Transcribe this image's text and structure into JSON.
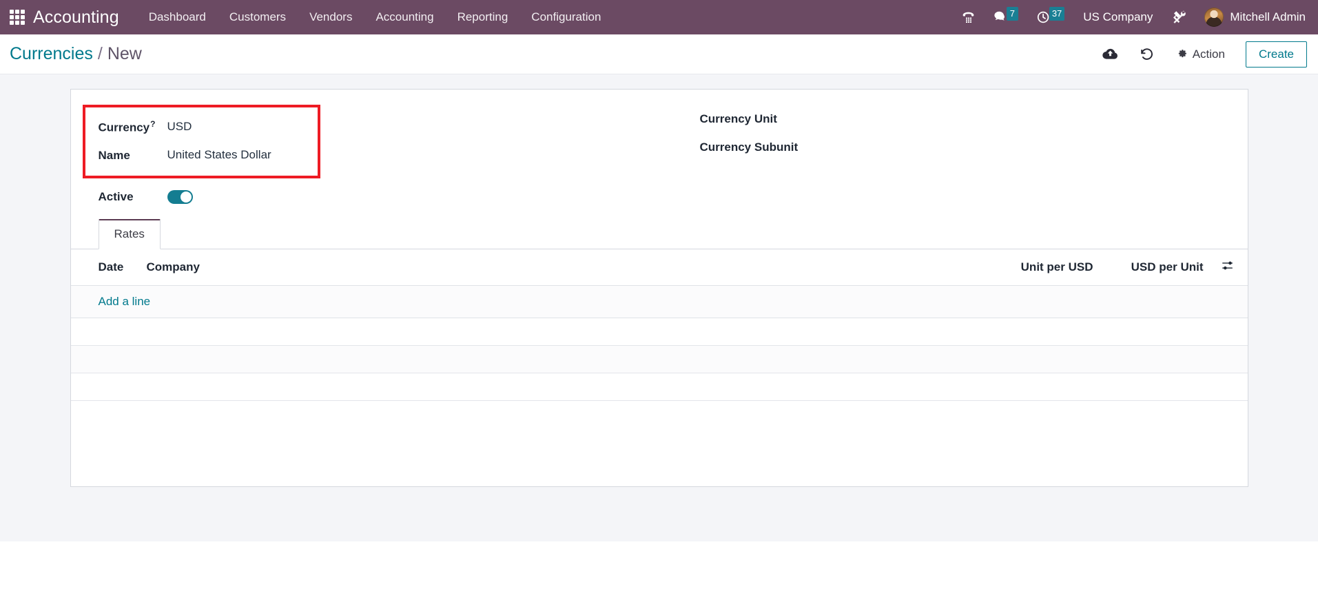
{
  "navbar": {
    "apps_icon": "apps-grid-icon",
    "brand": "Accounting",
    "menu": [
      {
        "label": "Dashboard"
      },
      {
        "label": "Customers"
      },
      {
        "label": "Vendors"
      },
      {
        "label": "Accounting"
      },
      {
        "label": "Reporting"
      },
      {
        "label": "Configuration"
      }
    ],
    "systray": {
      "phone_icon": "phone-dialpad-icon",
      "messages_icon": "chat-bubble-icon",
      "messages_count": "7",
      "activities_icon": "clock-icon",
      "activities_count": "37",
      "company": "US Company",
      "debug_icon": "tools-wrench-screwdriver-icon",
      "avatar": "user-avatar",
      "username": "Mitchell Admin"
    }
  },
  "control_panel": {
    "breadcrumb": {
      "root": "Currencies",
      "separator": "/",
      "current": "New"
    },
    "save_icon": "cloud-upload-icon",
    "discard_icon": "undo-arrow-icon",
    "action_icon": "gear-icon",
    "action_label": "Action",
    "create_label": "Create"
  },
  "form": {
    "left": {
      "currency_label": "Currency",
      "currency_tooltip_marker": "?",
      "currency_value": "USD",
      "name_label": "Name",
      "name_value": "United States Dollar",
      "active_label": "Active",
      "active_value": true
    },
    "right": {
      "currency_unit_label": "Currency Unit",
      "currency_unit_value": "",
      "currency_subunit_label": "Currency Subunit",
      "currency_subunit_value": ""
    }
  },
  "notebook": {
    "tabs": [
      {
        "label": "Rates",
        "active": true
      }
    ]
  },
  "rates_table": {
    "columns": [
      "Date",
      "Company",
      "Unit per USD",
      "USD per Unit"
    ],
    "optional_columns_icon": "sliders-toggle-icon",
    "rows": [],
    "add_line_label": "Add a line"
  },
  "colors": {
    "navbar_purple": "#6b4a63",
    "accent_teal": "#00798c",
    "badge_teal": "#1a7f94",
    "highlight_red": "#ee1b24",
    "tab_active_border": "#5b3a52",
    "page_background": "#f4f5f8"
  }
}
